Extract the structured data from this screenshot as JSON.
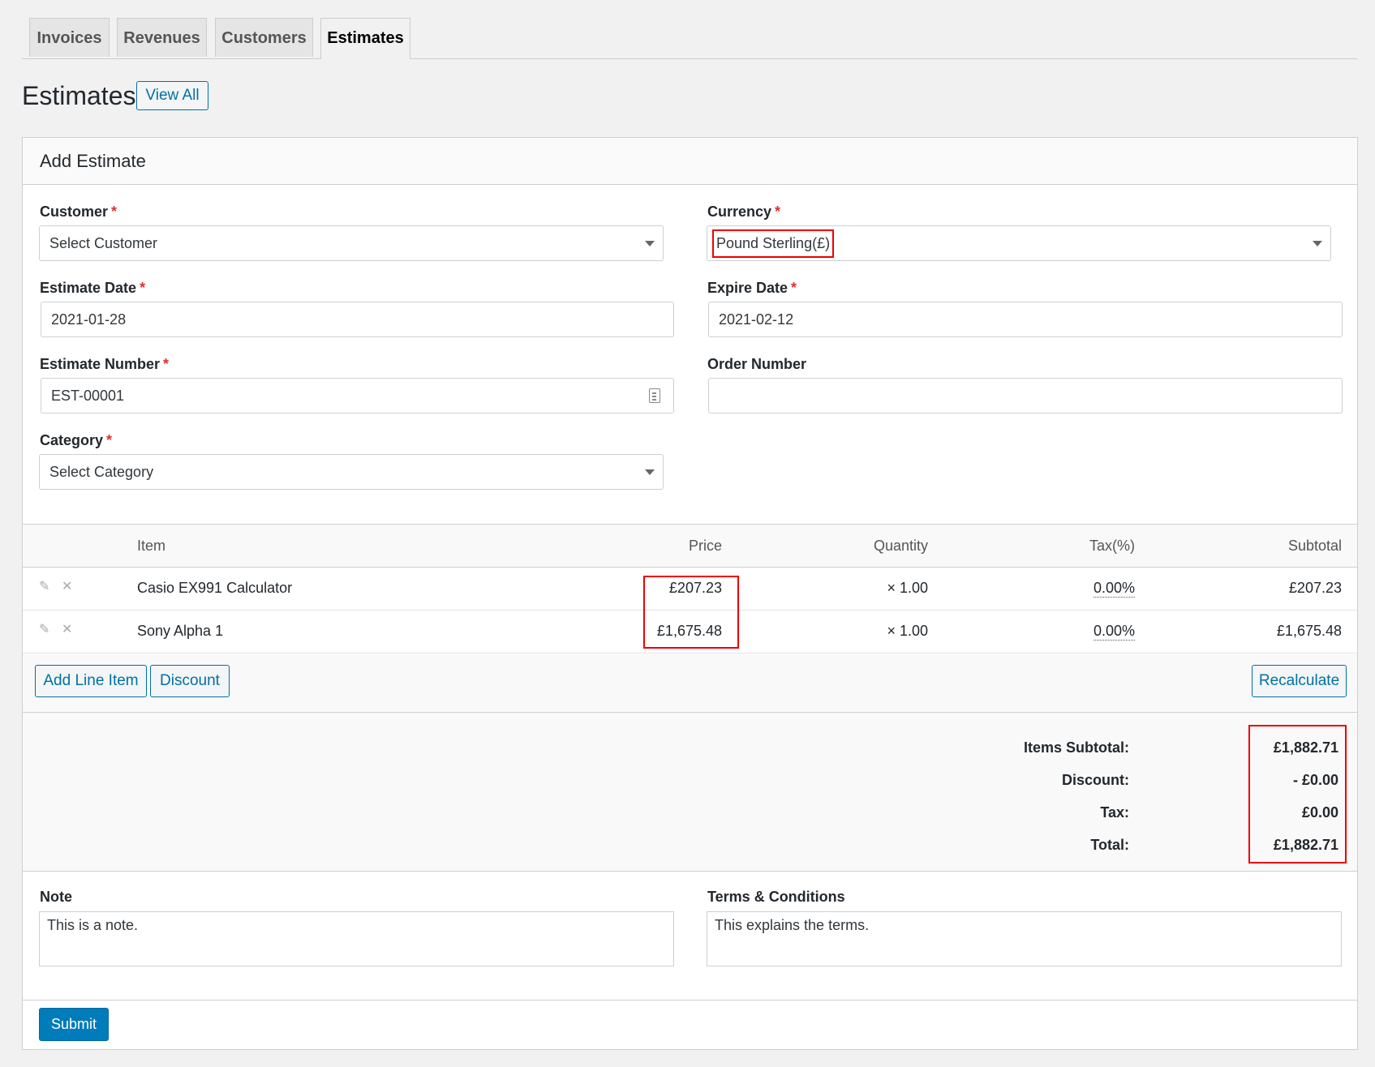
{
  "tabs": [
    "Invoices",
    "Revenues",
    "Customers",
    "Estimates"
  ],
  "page": {
    "title": "Estimates",
    "view_all": "View All"
  },
  "panel": {
    "title": "Add Estimate"
  },
  "form": {
    "customer": {
      "label": "Customer",
      "value": "Select Customer"
    },
    "currency": {
      "label": "Currency",
      "value": "Pound Sterling(£)"
    },
    "estimate_date": {
      "label": "Estimate Date",
      "value": "2021-01-28"
    },
    "expire_date": {
      "label": "Expire Date",
      "value": "2021-02-12"
    },
    "estimate_number": {
      "label": "Estimate Number",
      "value": "EST-00001"
    },
    "order_number": {
      "label": "Order Number",
      "value": ""
    },
    "category": {
      "label": "Category",
      "value": "Select Category"
    },
    "required_mark": "*"
  },
  "items": {
    "columns": [
      "Item",
      "Price",
      "Quantity",
      "Tax(%)",
      "Subtotal"
    ],
    "rows": [
      {
        "name": "Casio EX991 Calculator",
        "price": "£207.23",
        "quantity": "× 1.00",
        "tax": "0.00%",
        "subtotal": "£207.23"
      },
      {
        "name": "Sony Alpha 1",
        "price": "£1,675.48",
        "quantity": "× 1.00",
        "tax": "0.00%",
        "subtotal": "£1,675.48"
      }
    ],
    "add_line_item": "Add Line Item",
    "discount": "Discount",
    "recalculate": "Recalculate"
  },
  "totals": {
    "items_subtotal": {
      "label": "Items Subtotal:",
      "value": "£1,882.71"
    },
    "discount": {
      "label": "Discount:",
      "value": "- £0.00"
    },
    "tax": {
      "label": "Tax:",
      "value": "£0.00"
    },
    "total": {
      "label": "Total:",
      "value": "£1,882.71"
    }
  },
  "note": {
    "label": "Note",
    "value": "This is a note."
  },
  "terms": {
    "label": "Terms & Conditions",
    "value": "This explains the terms."
  },
  "submit": "Submit",
  "colors": {
    "accent": "#0071a1",
    "primary": "#007cba",
    "highlight": "#e00000",
    "required": "#dc3232"
  }
}
